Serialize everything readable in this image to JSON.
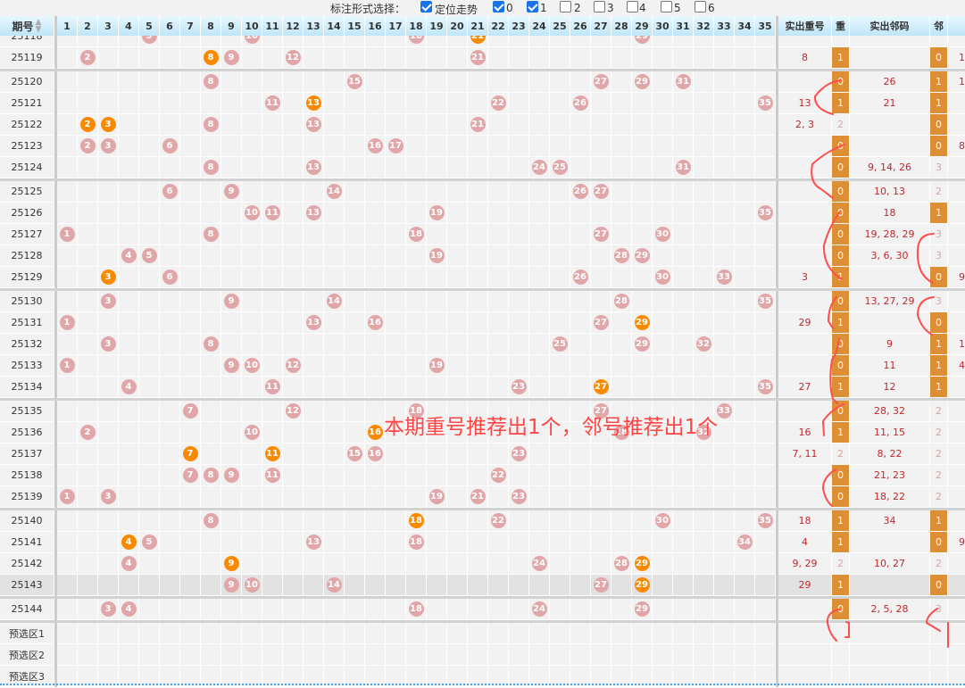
{
  "options": {
    "label": "标注形式选择：",
    "items": [
      {
        "text": "定位走势",
        "checked": true
      },
      {
        "text": "0",
        "checked": true
      },
      {
        "text": "1",
        "checked": true
      },
      {
        "text": "2",
        "checked": false
      },
      {
        "text": "3",
        "checked": false
      },
      {
        "text": "4",
        "checked": false
      },
      {
        "text": "5",
        "checked": false
      },
      {
        "text": "6",
        "checked": false
      }
    ]
  },
  "header": {
    "period": "期号",
    "numbers": [
      "1",
      "2",
      "3",
      "4",
      "5",
      "6",
      "7",
      "8",
      "9",
      "10",
      "11",
      "12",
      "13",
      "14",
      "15",
      "16",
      "17",
      "18",
      "19",
      "20",
      "21",
      "22",
      "23",
      "24",
      "25",
      "26",
      "27",
      "28",
      "29",
      "30",
      "31",
      "32",
      "33",
      "34",
      "35"
    ],
    "repeat_nums": "实出重号",
    "repeat": "重",
    "neighbor_nums": "实出邻码",
    "neighbor": "邻"
  },
  "colors": {
    "ball": "#e0a6a8",
    "ball_repeat": "#f98a00",
    "bar": "#dc8f35",
    "note": "#ff4444"
  },
  "rows": [
    {
      "p": "25118",
      "b": [
        5,
        10,
        18,
        21,
        29
      ],
      "o": [
        21
      ],
      "clip": true
    },
    {
      "p": "25119",
      "b": [
        2,
        8,
        9,
        12,
        21
      ],
      "o": [
        8
      ],
      "rn": "8",
      "r": 1,
      "nn": "",
      "n": 0,
      "x": "1"
    },
    {
      "p": "25120",
      "b": [
        8,
        15,
        27,
        29,
        31
      ],
      "o": [],
      "rn": "",
      "r": 0,
      "nn": "26",
      "n": 1,
      "x": "1",
      "g": true
    },
    {
      "p": "25121",
      "b": [
        11,
        13,
        22,
        26,
        35
      ],
      "o": [
        13
      ],
      "rn": "13",
      "r": 1,
      "nn": "21",
      "n": 1
    },
    {
      "p": "25122",
      "b": [
        2,
        3,
        8,
        13,
        21
      ],
      "o": [
        2,
        3
      ],
      "rn": "2, 3",
      "r": 2,
      "nn": "",
      "n": 0
    },
    {
      "p": "25123",
      "b": [
        2,
        3,
        6,
        16,
        17
      ],
      "o": [],
      "rn": "",
      "r": 0,
      "nn": "",
      "n": 0,
      "x": "8,"
    },
    {
      "p": "25124",
      "b": [
        8,
        13,
        24,
        25,
        31
      ],
      "o": [],
      "rn": "",
      "r": 0,
      "nn": "9, 14, 26",
      "n": 3
    },
    {
      "p": "25125",
      "b": [
        6,
        9,
        14,
        26,
        27
      ],
      "o": [],
      "rn": "",
      "r": 0,
      "nn": "10, 13",
      "n": 2,
      "g": true
    },
    {
      "p": "25126",
      "b": [
        10,
        11,
        13,
        19,
        35
      ],
      "o": [],
      "rn": "",
      "r": 0,
      "nn": "18",
      "n": 1
    },
    {
      "p": "25127",
      "b": [
        1,
        8,
        18,
        27,
        30
      ],
      "o": [],
      "rn": "",
      "r": 0,
      "nn": "19, 28, 29",
      "n": 3
    },
    {
      "p": "25128",
      "b": [
        4,
        5,
        19,
        28,
        29
      ],
      "o": [],
      "rn": "",
      "r": 0,
      "nn": "3, 6, 30",
      "n": 3
    },
    {
      "p": "25129",
      "b": [
        3,
        6,
        26,
        30,
        33
      ],
      "o": [
        3
      ],
      "rn": "3",
      "r": 1,
      "nn": "",
      "n": 0,
      "x": "9"
    },
    {
      "p": "25130",
      "b": [
        3,
        9,
        14,
        28,
        35
      ],
      "o": [],
      "rn": "",
      "r": 0,
      "nn": "13, 27, 29",
      "n": 3,
      "g": true
    },
    {
      "p": "25131",
      "b": [
        1,
        13,
        16,
        27,
        29
      ],
      "o": [
        29
      ],
      "rn": "29",
      "r": 1,
      "nn": "",
      "n": 0
    },
    {
      "p": "25132",
      "b": [
        3,
        8,
        25,
        29,
        32
      ],
      "o": [],
      "rn": "",
      "r": 0,
      "nn": "9",
      "n": 1,
      "x": "1"
    },
    {
      "p": "25133",
      "b": [
        1,
        9,
        10,
        12,
        19
      ],
      "o": [],
      "rn": "",
      "r": 0,
      "nn": "11",
      "n": 1,
      "x": "4"
    },
    {
      "p": "25134",
      "b": [
        4,
        11,
        23,
        27,
        35
      ],
      "o": [
        27
      ],
      "rn": "27",
      "r": 1,
      "nn": "12",
      "n": 1
    },
    {
      "p": "25135",
      "b": [
        7,
        12,
        18,
        27,
        33
      ],
      "o": [],
      "rn": "",
      "r": 0,
      "nn": "28, 32",
      "n": 2,
      "g": true
    },
    {
      "p": "25136",
      "b": [
        2,
        10,
        16,
        28,
        32
      ],
      "o": [
        16
      ],
      "rn": "16",
      "r": 1,
      "nn": "11, 15",
      "n": 2
    },
    {
      "p": "25137",
      "b": [
        7,
        11,
        15,
        16,
        23
      ],
      "o": [
        7,
        11
      ],
      "rn": "7, 11",
      "r": 2,
      "nn": "8, 22",
      "n": 2
    },
    {
      "p": "25138",
      "b": [
        7,
        8,
        9,
        11,
        22
      ],
      "o": [],
      "rn": "",
      "r": 0,
      "nn": "21, 23",
      "n": 2
    },
    {
      "p": "25139",
      "b": [
        1,
        3,
        19,
        21,
        23
      ],
      "o": [],
      "rn": "",
      "r": 0,
      "nn": "18, 22",
      "n": 2
    },
    {
      "p": "25140",
      "b": [
        8,
        18,
        22,
        30,
        35
      ],
      "o": [
        18
      ],
      "rn": "18",
      "r": 1,
      "nn": "34",
      "n": 1,
      "g": true
    },
    {
      "p": "25141",
      "b": [
        4,
        5,
        13,
        18,
        34
      ],
      "o": [
        4
      ],
      "rn": "4",
      "r": 1,
      "nn": "",
      "n": 0,
      "x": "9"
    },
    {
      "p": "25142",
      "b": [
        4,
        9,
        24,
        28,
        29
      ],
      "o": [
        9,
        29
      ],
      "rn": "9, 29",
      "r": 2,
      "nn": "10, 27",
      "n": 2
    },
    {
      "p": "25143",
      "b": [
        9,
        10,
        14,
        27,
        29
      ],
      "o": [
        29
      ],
      "rn": "29",
      "r": 1,
      "nn": "",
      "n": 0,
      "hl": true
    },
    {
      "p": "25144",
      "b": [
        3,
        4,
        18,
        24,
        29
      ],
      "o": [],
      "rn": "",
      "r": 0,
      "nn": "2, 5, 28",
      "n": 3,
      "g": true
    },
    {
      "p": "预选区1",
      "b": [],
      "o": [],
      "pre": true,
      "g": true
    },
    {
      "p": "预选区2",
      "b": [],
      "o": [],
      "pre": true
    },
    {
      "p": "预选区3",
      "b": [],
      "o": [],
      "pre": true
    }
  ],
  "note": "本期重号推荐出1个，邻号推荐出1个"
}
